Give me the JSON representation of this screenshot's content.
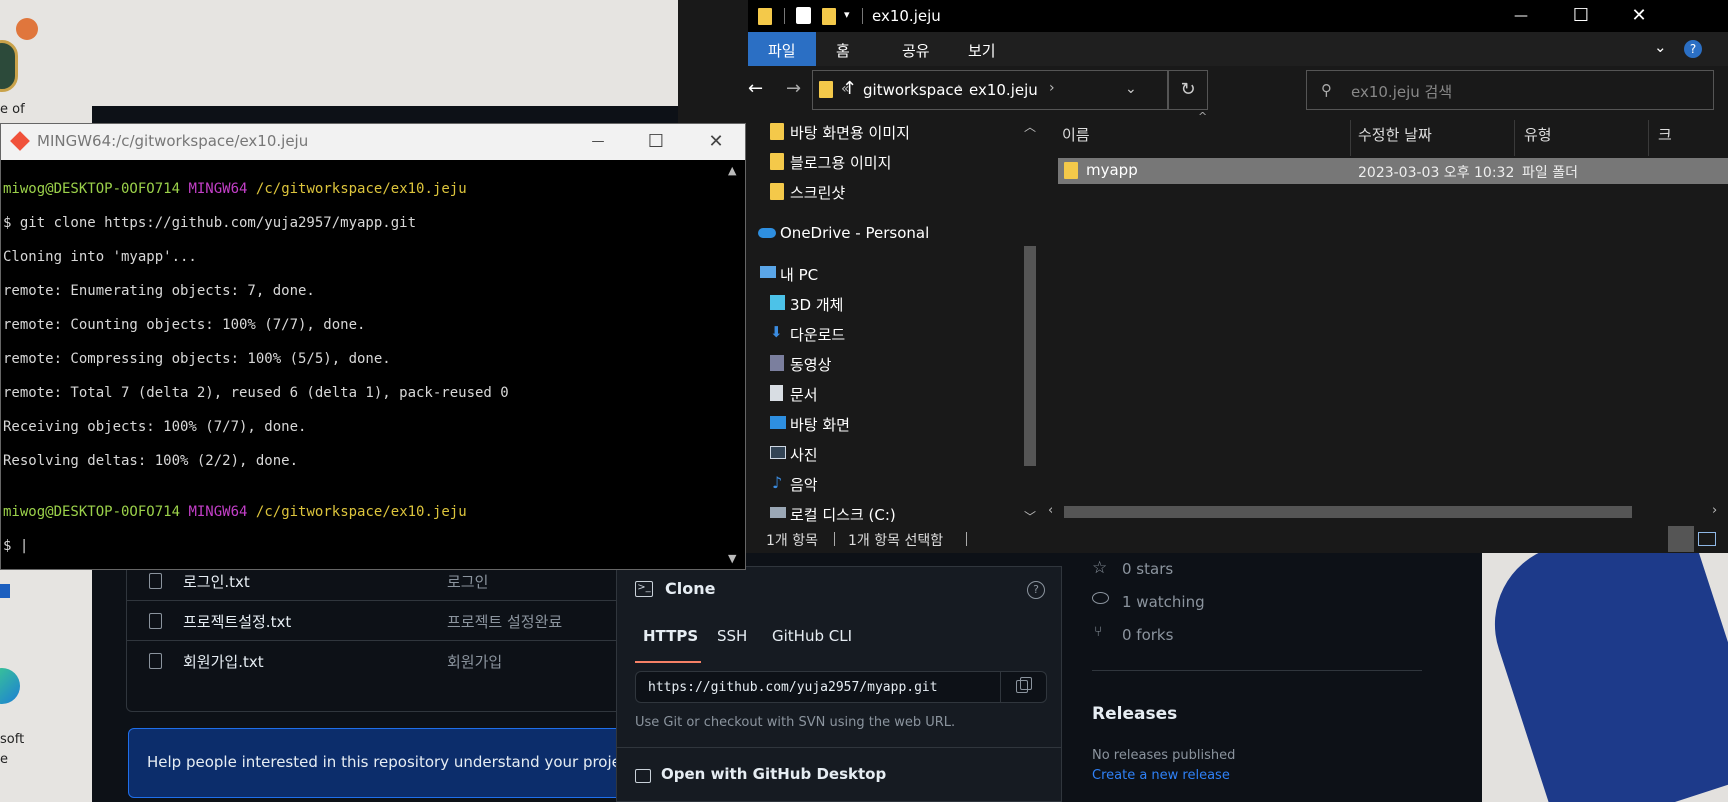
{
  "desktop": {
    "icon_labels": [
      "e of",
      "soft",
      "e"
    ]
  },
  "bash": {
    "title": "MINGW64:/c/gitworkspace/ex10.jeju",
    "controls": {
      "minimize": "—",
      "maximize": "☐",
      "close": "✕"
    },
    "lines": [
      {
        "user": "miwog@DESKTOP-0OFO714",
        "env": "MINGW64",
        "path": "/c/gitworkspace/ex10.jeju"
      },
      {
        "text": "$ git clone https://github.com/yuja2957/myapp.git"
      },
      {
        "text": "Cloning into 'myapp'..."
      },
      {
        "text": "remote: Enumerating objects: 7, done."
      },
      {
        "text": "remote: Counting objects: 100% (7/7), done."
      },
      {
        "text": "remote: Compressing objects: 100% (5/5), done."
      },
      {
        "text": "remote: Total 7 (delta 2), reused 6 (delta 1), pack-reused 0"
      },
      {
        "text": "Receiving objects: 100% (7/7), done."
      },
      {
        "text": "Resolving deltas: 100% (2/2), done."
      },
      {
        "text": ""
      },
      {
        "user": "miwog@DESKTOP-0OFO714",
        "env": "MINGW64",
        "path": "/c/gitworkspace/ex10.jeju"
      },
      {
        "text": "$ |"
      }
    ]
  },
  "explorer": {
    "title": "ex10.jeju",
    "controls": {
      "minimize": "—",
      "maximize": "☐",
      "close": "✕"
    },
    "ribbon_tabs": [
      "파일",
      "홈",
      "공유",
      "보기"
    ],
    "behind_tab": "파일",
    "breadcrumb": [
      "«",
      "gitworkspace",
      "ex10.jeju"
    ],
    "search_placeholder": "ex10.jeju 검색",
    "nav_items": [
      {
        "label": "바탕 화면용 이미지",
        "icon": "folder-icon"
      },
      {
        "label": "블로그용 이미지",
        "icon": "folder-icon"
      },
      {
        "label": "스크린샷",
        "icon": "folder-icon"
      },
      {
        "label": "OneDrive - Personal",
        "icon": "cloud-icon"
      },
      {
        "label": "내 PC",
        "icon": "pc-icon"
      },
      {
        "label": "3D 개체",
        "icon": "cube-icon"
      },
      {
        "label": "다운로드",
        "icon": "download-icon"
      },
      {
        "label": "동영상",
        "icon": "video-icon"
      },
      {
        "label": "문서",
        "icon": "document-icon"
      },
      {
        "label": "바탕 화면",
        "icon": "desktop-icon"
      },
      {
        "label": "사진",
        "icon": "picture-icon"
      },
      {
        "label": "음악",
        "icon": "music-icon"
      },
      {
        "label": "로컬 디스크 (C:)",
        "icon": "drive-icon"
      }
    ],
    "columns": [
      "이름",
      "수정한 날짜",
      "유형",
      "크"
    ],
    "files": [
      {
        "name": "myapp",
        "modified": "2023-03-03 오후 10:32",
        "type": "파일 폴더"
      }
    ],
    "status": {
      "count": "1개 항목",
      "selected": "1개 항목 선택함"
    }
  },
  "github": {
    "files": [
      {
        "name": "로그인.txt",
        "message": "로그인"
      },
      {
        "name": "프로젝트설정.txt",
        "message": "프로젝트 설정완료"
      },
      {
        "name": "회원가입.txt",
        "message": "회원가입"
      }
    ],
    "banner": "Help people interested in this repository understand your project by",
    "clone": {
      "title": "Clone",
      "tabs": [
        "HTTPS",
        "SSH",
        "GitHub CLI"
      ],
      "url": "https://github.com/yuja2957/myapp.git",
      "hint": "Use Git or checkout with SVN using the web URL.",
      "desktop": "Open with GitHub Desktop"
    },
    "stats": {
      "stars": "0 stars",
      "watching": "1 watching",
      "forks": "0 forks"
    },
    "releases": {
      "title": "Releases",
      "none": "No releases published",
      "create": "Create a new release"
    }
  }
}
